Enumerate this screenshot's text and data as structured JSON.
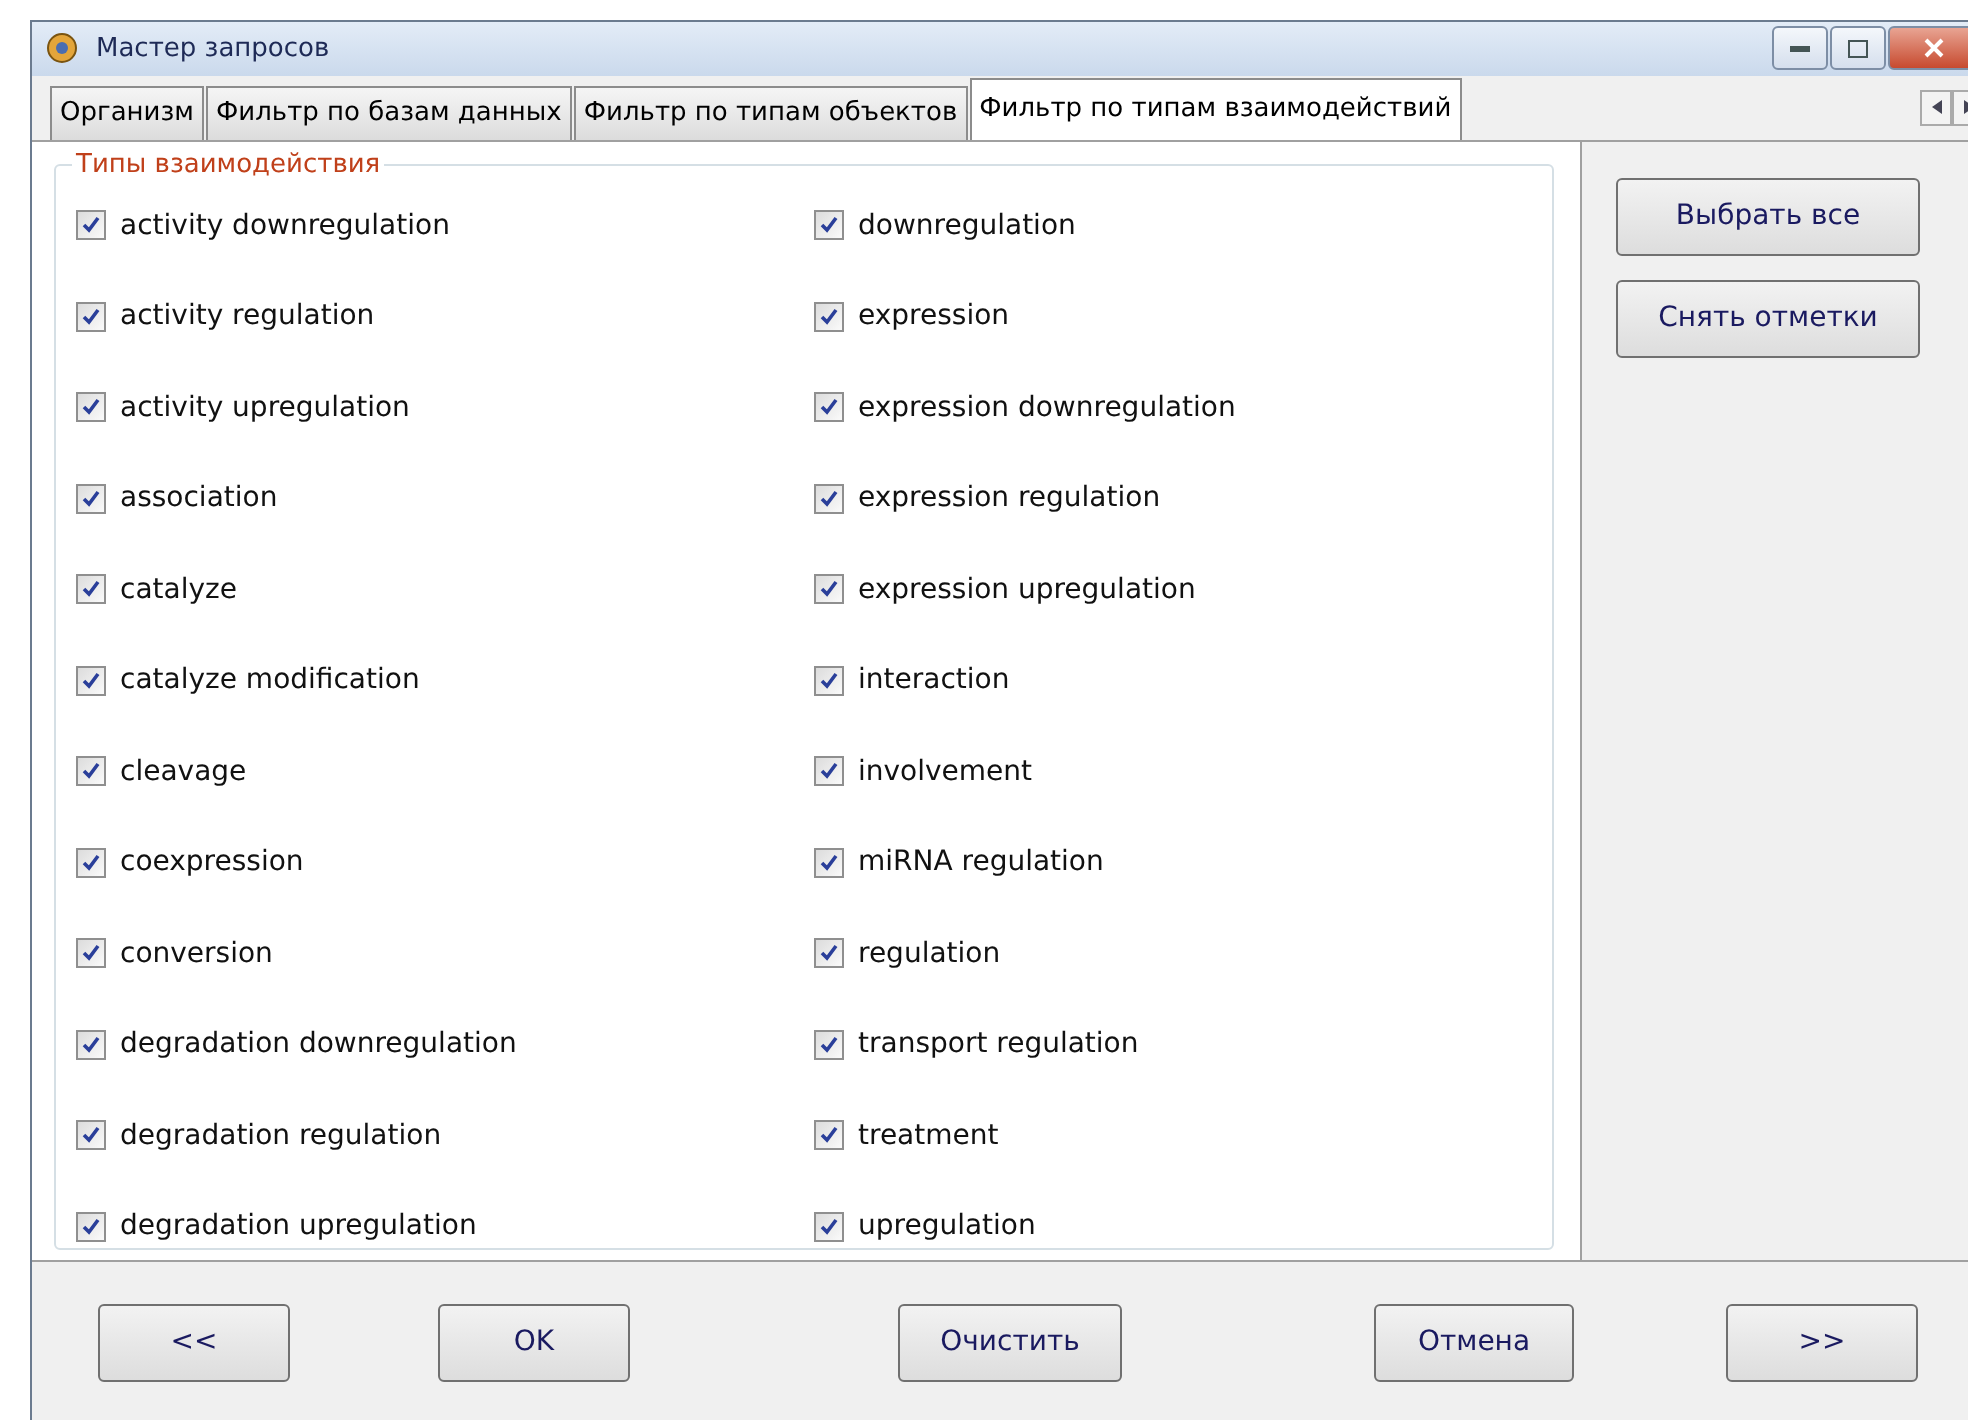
{
  "window": {
    "title": "Мастер запросов"
  },
  "tabs": [
    {
      "label": "Организм",
      "selected": false
    },
    {
      "label": "Фильтр по базам данных",
      "selected": false
    },
    {
      "label": "Фильтр по типам объектов",
      "selected": false
    },
    {
      "label": "Фильтр по типам взаимодействий",
      "selected": true
    }
  ],
  "group": {
    "title": "Типы взаимодействия",
    "columns": [
      [
        {
          "label": "activity downregulation",
          "checked": true
        },
        {
          "label": "activity regulation",
          "checked": true
        },
        {
          "label": "activity upregulation",
          "checked": true
        },
        {
          "label": "association",
          "checked": true
        },
        {
          "label": "catalyze",
          "checked": true
        },
        {
          "label": "catalyze modification",
          "checked": true
        },
        {
          "label": "cleavage",
          "checked": true
        },
        {
          "label": "coexpression",
          "checked": true
        },
        {
          "label": "conversion",
          "checked": true
        },
        {
          "label": "degradation downregulation",
          "checked": true
        },
        {
          "label": "degradation regulation",
          "checked": true
        },
        {
          "label": "degradation upregulation",
          "checked": true
        }
      ],
      [
        {
          "label": "downregulation",
          "checked": true
        },
        {
          "label": "expression",
          "checked": true
        },
        {
          "label": "expression downregulation",
          "checked": true
        },
        {
          "label": "expression regulation",
          "checked": true
        },
        {
          "label": "expression upregulation",
          "checked": true
        },
        {
          "label": "interaction",
          "checked": true
        },
        {
          "label": "involvement",
          "checked": true
        },
        {
          "label": "miRNA regulation",
          "checked": true
        },
        {
          "label": "regulation",
          "checked": true
        },
        {
          "label": "transport regulation",
          "checked": true
        },
        {
          "label": "treatment",
          "checked": true
        },
        {
          "label": "upregulation",
          "checked": true
        }
      ]
    ]
  },
  "side_buttons": [
    "Выбрать все",
    "Снять отметки"
  ],
  "footer_buttons": [
    "<<",
    "OK",
    "Очистить",
    "Отмена",
    ">>"
  ]
}
